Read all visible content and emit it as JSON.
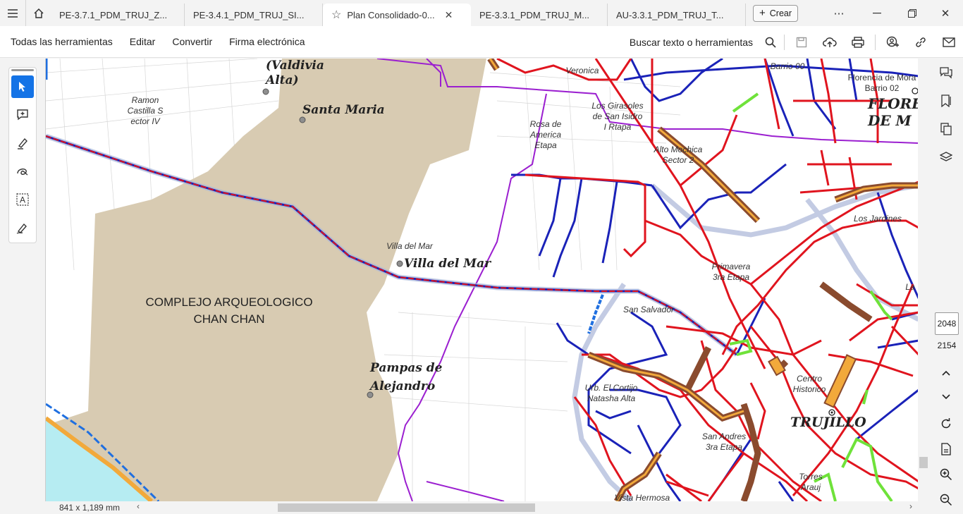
{
  "tabs": [
    {
      "label": "PE-3.7.1_PDM_TRUJ_Z...",
      "active": false
    },
    {
      "label": "PE-3.4.1_PDM_TRUJ_SI...",
      "active": false
    },
    {
      "label": "Plan Consolidado-0...",
      "active": true
    },
    {
      "label": "PE-3.3.1_PDM_TRUJ_M...",
      "active": false
    },
    {
      "label": "AU-3.3.1_PDM_TRUJ_T...",
      "active": false
    }
  ],
  "create_label": "Crear",
  "menu": {
    "all_tools": "Todas las herramientas",
    "edit": "Editar",
    "convert": "Convertir",
    "sign": "Firma electrónica"
  },
  "search_label": "Buscar texto o herramientas",
  "page": {
    "current": "2048",
    "total": "2154"
  },
  "page_size": "841 x 1,189 mm",
  "map": {
    "places": {
      "valdivia": "(Valdivia\nAlta)",
      "santa_maria": "Santa Maria",
      "villa_del_mar_big": "Villa del Mar",
      "pampas": "Pampas de\nAlejandro",
      "trujillo": "TRUJILLO",
      "flor": "FLORE\nDE M"
    },
    "small_labels": {
      "ramon": "Ramon\nCastilla S\nector IV",
      "rosa": "Rosa de\nAmerica\nEtapa",
      "girasoles": "Los Girasoles\nde San Isidro\nI Rtapa",
      "alto_mochica": "Alto Mochica\nSector 2",
      "florencia": "Florencia de Mora\nBarrio 02",
      "barrio": "Barrio 00",
      "veronica": "Veronica",
      "villa_mar_small": "Villa del Mar",
      "primavera": "Primavera\n3ra Etapa",
      "jardines": "Los Jardines",
      "la": "La",
      "san_salvador": "San Salvador",
      "cortijo": "Urb. El Cortijo\nNatasha Alta",
      "centro": "Centro\nHistorico",
      "san_andres": "San Andres\n3ra Etapa",
      "torres": "Torres\nArauj",
      "vista": "Vista Hermosa"
    },
    "complex": "COMPLEJO ARQUEOLOGICO\nCHAN CHAN",
    "colors": {
      "chan_chan": "#d8cbb2",
      "red_road": "#e0141e",
      "blue_road": "#1a22b8",
      "purple_border": "#9b1fd0",
      "green": "#6fe23a",
      "brown": "#8a4b2e",
      "orange": "#f2a93b",
      "ocean": "#b6ecf2"
    }
  }
}
